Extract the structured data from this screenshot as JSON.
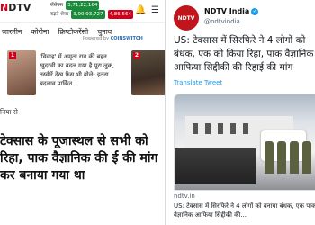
{
  "left": {
    "logo_prefix": "N",
    "logo_suffix": "DTV",
    "ticker": {
      "row1_name": "सेंसेक्स",
      "row1_value": "3,71,22,164",
      "row2_name": "बढ़ते शेयर",
      "row2_value": "3,90,93,727",
      "row2_extra": "4,86,564"
    },
    "nav": {
      "items": [
        "ज़ारतीन",
        "कोरोना",
        "क्रिप्टोकरेंसी",
        "चुनाव"
      ],
      "powered_by_label": "Powered by",
      "powered_by_brand": "COINSWITCH"
    },
    "cards": [
      {
        "number": "1",
        "text": "'विवाह' में अमृता राव की बहन खुदरवी का बदल गया है पूरा लुक, तस्वीरें देख फैंस भी बोले- इतना बदलाव पार्किन..."
      },
      {
        "number": "2",
        "text": ""
      }
    ],
    "section_label": "निया से",
    "headline": "टेक्सास के पूजास्थल से सभी को रिहा, पाक वैज्ञानिक की र्ई की मांग कर बनाया गया था"
  },
  "right": {
    "avatar_label": "NDTV",
    "name": "NDTV India",
    "verified_glyph": "✓",
    "handle": "@ndtvindia",
    "tweet_text": "US: टेक्सास में सिरफिरे ने 4 लोगों को बंधक, एक को किया रिहा, पाक वैज्ञानिक आफिया सिद्दीकी की रिहाई की मांग",
    "translate_label": "Translate Tweet",
    "card_source": "ndtv.in",
    "card_caption": "US: टेक्सास में सिरफिरे ने 4 लोगों को बनाया बंधक, एक पाक वैज्ञानिक आफिया सिद्दीकी की..."
  },
  "icons": {
    "notifications": "bell-icon",
    "menu": "menu-icon"
  },
  "colors": {
    "brand_red": "#d0021b",
    "ticker_green": "#1b8a3a",
    "link_blue": "#1d9bf0"
  }
}
